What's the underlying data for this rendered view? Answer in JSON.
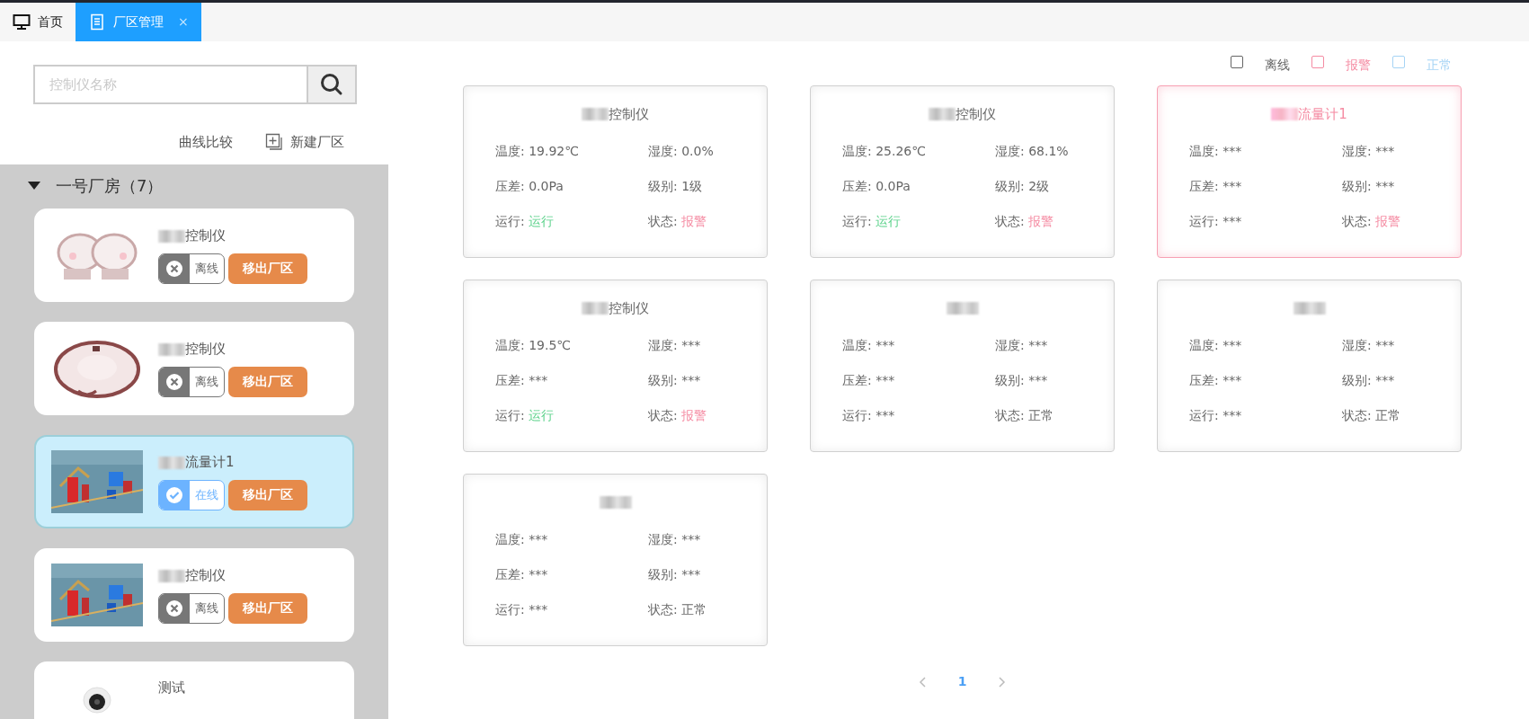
{
  "tabs": [
    {
      "label": "首页",
      "selected": false
    },
    {
      "label": "厂区管理",
      "selected": true,
      "close": "×"
    }
  ],
  "search": {
    "placeholder": "控制仪名称"
  },
  "actions": [
    {
      "label": "曲线比较",
      "kind": "plain"
    },
    {
      "label": "新建厂区",
      "kind": "add"
    }
  ],
  "group": {
    "label": "一号厂房（7）",
    "expanded": true
  },
  "devices": [
    {
      "name": "控制仪",
      "redacted": true,
      "online": false,
      "status": "离线",
      "button": "移出厂区",
      "selected": false
    },
    {
      "name": "控制仪",
      "redacted": true,
      "online": false,
      "status": "离线",
      "button": "移出厂区",
      "selected": false
    },
    {
      "name": "流量计1",
      "redacted": true,
      "online": true,
      "status": "在线",
      "button": "移出厂区",
      "selected": true
    },
    {
      "name": "控制仪",
      "redacted": true,
      "online": false,
      "status": "离线",
      "button": "移出厂区",
      "selected": false
    },
    {
      "name": "测试",
      "redacted": false,
      "selected": false
    }
  ],
  "legend": [
    {
      "label": "离线",
      "color": "#666666",
      "checked": false
    },
    {
      "label": "报警",
      "color": "#f58ca3",
      "checked": false
    },
    {
      "label": "正常",
      "color": "#a6d4f5",
      "checked": false
    }
  ],
  "cards": [
    {
      "name": "控制仪",
      "redacted": true,
      "alarm": false,
      "fields": [
        {
          "label": "温度:",
          "value": "19.92℃",
          "kind": "plain"
        },
        {
          "label": "湿度:",
          "value": "0.0%",
          "kind": "plain"
        },
        {
          "label": "压差:",
          "value": "0.0Pa",
          "kind": "plain"
        },
        {
          "label": "级别:",
          "value": "1级",
          "kind": "plain"
        },
        {
          "label": "运行:",
          "value": "运行",
          "kind": "ok"
        },
        {
          "label": "状态:",
          "value": "报警",
          "kind": "alarm"
        }
      ]
    },
    {
      "name": "控制仪",
      "redacted": true,
      "alarm": false,
      "fields": [
        {
          "label": "温度:",
          "value": "25.26℃",
          "kind": "plain"
        },
        {
          "label": "湿度:",
          "value": "68.1%",
          "kind": "plain"
        },
        {
          "label": "压差:",
          "value": "0.0Pa",
          "kind": "plain"
        },
        {
          "label": "级别:",
          "value": "2级",
          "kind": "plain"
        },
        {
          "label": "运行:",
          "value": "运行",
          "kind": "ok"
        },
        {
          "label": "状态:",
          "value": "报警",
          "kind": "alarm"
        }
      ]
    },
    {
      "name": "流量计1",
      "redacted": true,
      "alarm": true,
      "fields": [
        {
          "label": "温度:",
          "value": "***",
          "kind": "plain"
        },
        {
          "label": "湿度:",
          "value": "***",
          "kind": "plain"
        },
        {
          "label": "压差:",
          "value": "***",
          "kind": "plain"
        },
        {
          "label": "级别:",
          "value": "***",
          "kind": "plain"
        },
        {
          "label": "运行:",
          "value": "***",
          "kind": "plain"
        },
        {
          "label": "状态:",
          "value": "报警",
          "kind": "alarm"
        }
      ]
    },
    {
      "name": "控制仪",
      "redacted": true,
      "alarm": false,
      "fields": [
        {
          "label": "温度:",
          "value": "19.5℃",
          "kind": "plain"
        },
        {
          "label": "湿度:",
          "value": "***",
          "kind": "plain"
        },
        {
          "label": "压差:",
          "value": "***",
          "kind": "plain"
        },
        {
          "label": "级别:",
          "value": "***",
          "kind": "plain"
        },
        {
          "label": "运行:",
          "value": "运行",
          "kind": "ok"
        },
        {
          "label": "状态:",
          "value": "报警",
          "kind": "alarm"
        }
      ]
    },
    {
      "redacted": true,
      "alarm": false,
      "fields": [
        {
          "label": "温度:",
          "value": "***",
          "kind": "plain"
        },
        {
          "label": "湿度:",
          "value": "***",
          "kind": "plain"
        },
        {
          "label": "压差:",
          "value": "***",
          "kind": "plain"
        },
        {
          "label": "级别:",
          "value": "***",
          "kind": "plain"
        },
        {
          "label": "运行:",
          "value": "***",
          "kind": "plain"
        },
        {
          "label": "状态:",
          "value": "正常",
          "kind": "plain"
        }
      ]
    },
    {
      "redacted": true,
      "alarm": false,
      "fields": [
        {
          "label": "温度:",
          "value": "***",
          "kind": "plain"
        },
        {
          "label": "湿度:",
          "value": "***",
          "kind": "plain"
        },
        {
          "label": "压差:",
          "value": "***",
          "kind": "plain"
        },
        {
          "label": "级别:",
          "value": "***",
          "kind": "plain"
        },
        {
          "label": "运行:",
          "value": "***",
          "kind": "plain"
        },
        {
          "label": "状态:",
          "value": "正常",
          "kind": "plain"
        }
      ]
    },
    {
      "redacted": true,
      "alarm": false,
      "fields": [
        {
          "label": "温度:",
          "value": "***",
          "kind": "plain"
        },
        {
          "label": "湿度:",
          "value": "***",
          "kind": "plain"
        },
        {
          "label": "压差:",
          "value": "***",
          "kind": "plain"
        },
        {
          "label": "级别:",
          "value": "***",
          "kind": "plain"
        },
        {
          "label": "运行:",
          "value": "***",
          "kind": "plain"
        },
        {
          "label": "状态:",
          "value": "正常",
          "kind": "plain"
        }
      ]
    }
  ],
  "pagination": {
    "pages": [
      {
        "label": "1",
        "selected": true
      }
    ]
  }
}
